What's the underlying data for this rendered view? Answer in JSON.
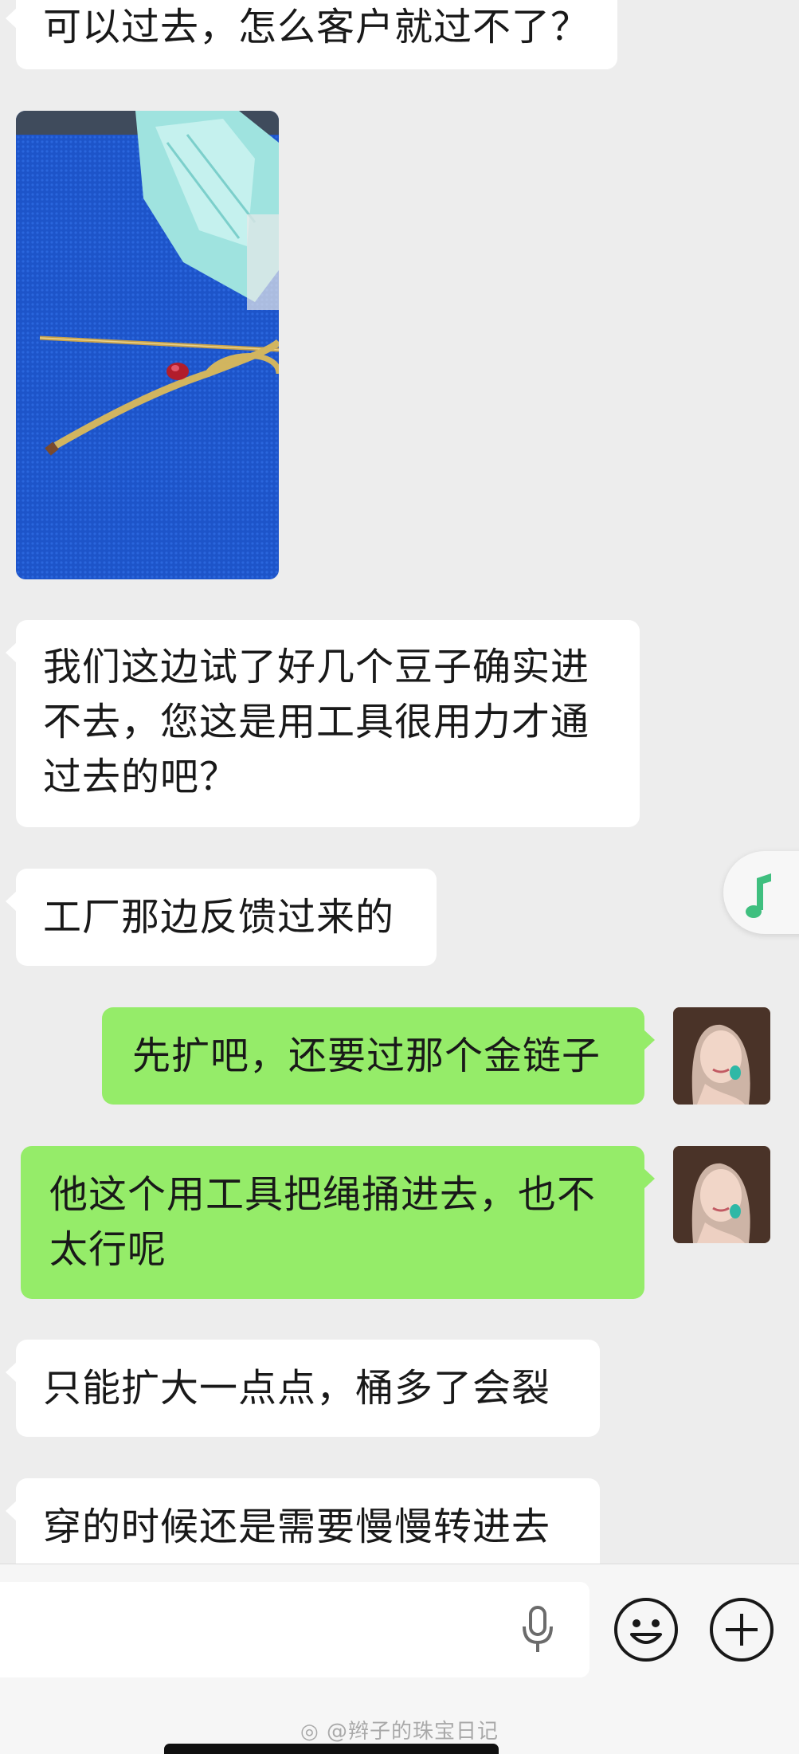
{
  "messages": [
    {
      "side": "in",
      "text": "可以过去，怎么客户就过不了？"
    },
    {
      "side": "in",
      "type": "image",
      "image_desc": "photo"
    },
    {
      "side": "in",
      "text": "我们这边试了好几个豆子确实进不去，您这是用工具很用力才通过去的吧？"
    },
    {
      "side": "in",
      "text": "工厂那边反馈过来的"
    },
    {
      "side": "out",
      "text": "先扩吧，还要过那个金链子"
    },
    {
      "side": "out",
      "text": "他这个用工具把绳捅进去，也不太行呢"
    },
    {
      "side": "in",
      "text": "只能扩大一点点，桶多了会裂"
    },
    {
      "side": "in",
      "text": "穿的时候还是需要慢慢转进去"
    }
  ],
  "floating": {
    "icon": "music-note-icon",
    "color": "#3fbf7f"
  },
  "input_bar": {
    "value": "",
    "icons": [
      "microphone-icon",
      "emoji-icon",
      "plus-icon"
    ]
  },
  "watermark": "@辫子的珠宝日记",
  "colors": {
    "incoming_bubble": "#ffffff",
    "outgoing_bubble": "#95ec69",
    "background": "#ededed"
  }
}
